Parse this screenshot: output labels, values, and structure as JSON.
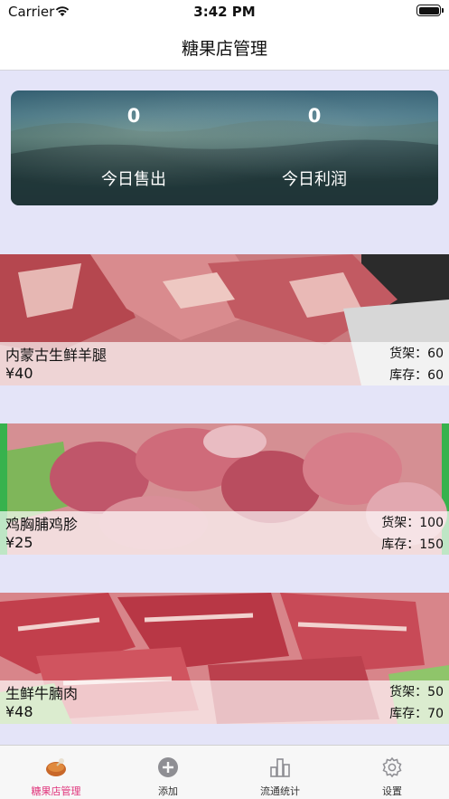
{
  "status_bar": {
    "carrier": "Carrier",
    "time": "3:42 PM"
  },
  "nav": {
    "title": "糖果店管理"
  },
  "summary": {
    "sales_value": "0",
    "sales_label": "今日售出",
    "profit_value": "0",
    "profit_label": "今日利润"
  },
  "products": [
    {
      "name": "内蒙古生鲜羊腿",
      "price": "¥40",
      "shelf": "货架：60",
      "stock": "库存：60"
    },
    {
      "name": "鸡胸脯鸡胗",
      "price": "¥25",
      "shelf": "货架：100",
      "stock": "库存：150"
    },
    {
      "name": "生鲜牛腩肉",
      "price": "¥48",
      "shelf": "货架：50",
      "stock": "库存：70"
    }
  ],
  "tabs": [
    {
      "label": "糖果店管理",
      "icon": "candy-store-icon",
      "active": true
    },
    {
      "label": "添加",
      "icon": "add-circle-icon",
      "active": false
    },
    {
      "label": "流通统计",
      "icon": "bar-chart-icon",
      "active": false
    },
    {
      "label": "设置",
      "icon": "gear-icon",
      "active": false
    }
  ],
  "colors": {
    "active_tab": "#e0367c",
    "background": "#e4e4f8"
  }
}
